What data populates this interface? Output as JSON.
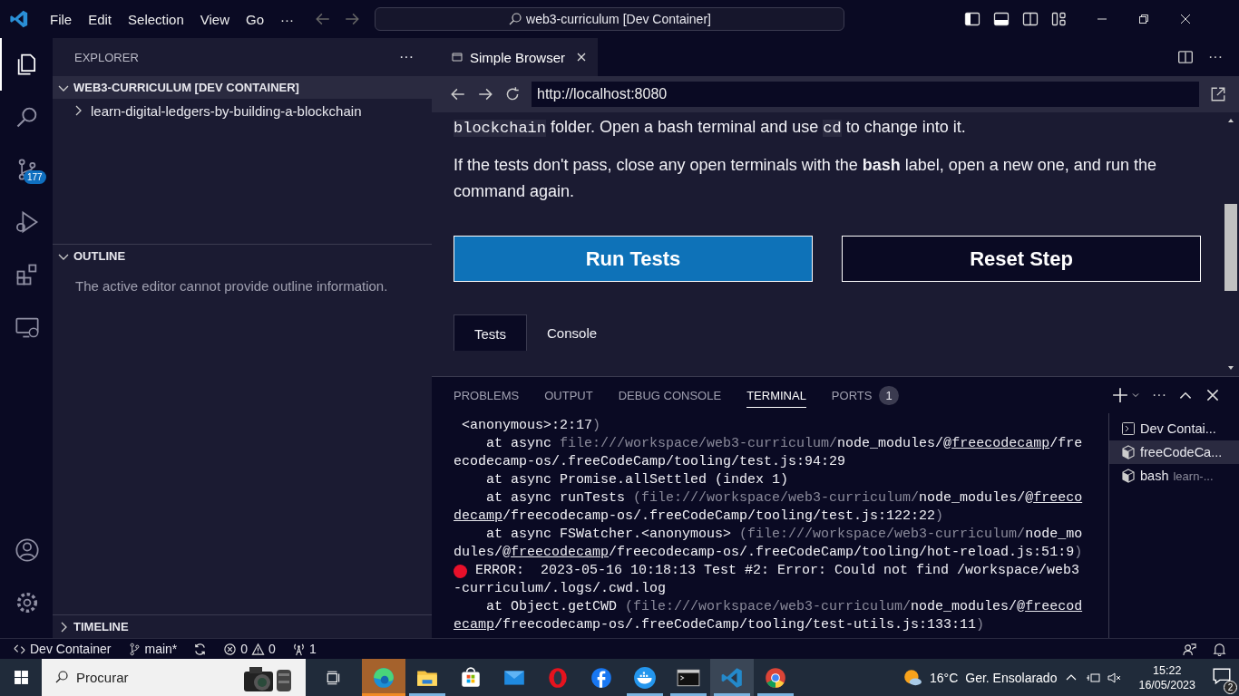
{
  "title_bar": {
    "menus": [
      "File",
      "Edit",
      "Selection",
      "View",
      "Go",
      "···"
    ],
    "command_center": "web3-curriculum [Dev Container]",
    "layout_toggles": [
      {
        "kind": "primary-sidebar",
        "on": true
      },
      {
        "kind": "panel",
        "on": true
      },
      {
        "kind": "secondary-sidebar",
        "on": false
      },
      {
        "kind": "customize"
      }
    ]
  },
  "activity_bar": {
    "top": [
      {
        "kind": "explorer",
        "selected": true
      },
      {
        "kind": "search",
        "selected": false
      },
      {
        "kind": "source-control",
        "selected": false,
        "badge": "177"
      },
      {
        "kind": "run-debug",
        "selected": false
      },
      {
        "kind": "extensions",
        "selected": false
      },
      {
        "kind": "remote",
        "selected": false
      }
    ],
    "bottom": [
      {
        "kind": "account"
      },
      {
        "kind": "manage"
      }
    ]
  },
  "sidebar": {
    "title": "EXPLORER",
    "more": "···",
    "sections": [
      {
        "kind": "tree",
        "title": "WEB3-CURRICULUM [DEV CONTAINER]",
        "expanded": true,
        "items": [
          {
            "label": "learn-digital-ledgers-by-building-a-blockchain",
            "expanded": false
          }
        ]
      },
      {
        "kind": "message",
        "title": "OUTLINE",
        "expanded": true,
        "message": "The active editor cannot provide outline information."
      },
      {
        "kind": "collapsed",
        "title": "TIMELINE",
        "expanded": false
      }
    ]
  },
  "editor": {
    "tabs": [
      {
        "label": "Simple Browser",
        "selected": true
      }
    ],
    "browser": {
      "url": "http://localhost:8080",
      "first_line": [
        {
          "kind": "code",
          "text": "blockchain"
        },
        {
          "kind": "text",
          "text": " folder. Open a bash terminal and use "
        },
        {
          "kind": "code",
          "text": "cd"
        },
        {
          "kind": "text",
          "text": " to change into it."
        }
      ],
      "paragraph": "If the tests don't pass, close any open terminals with the **bash** label, open a new one, and run the command again.",
      "buttons": [
        {
          "label": "Run Tests",
          "kind": "primary"
        },
        {
          "label": "Reset Step",
          "kind": "secondary"
        }
      ],
      "tabs": [
        {
          "label": "Tests",
          "selected": true
        },
        {
          "label": "Console",
          "selected": false
        }
      ]
    }
  },
  "panel": {
    "tabs": [
      {
        "label": "PROBLEMS",
        "selected": false
      },
      {
        "label": "OUTPUT",
        "selected": false
      },
      {
        "label": "DEBUG CONSOLE",
        "selected": false
      },
      {
        "label": "TERMINAL",
        "selected": true
      },
      {
        "label": "PORTS",
        "selected": false,
        "badge": "1"
      }
    ],
    "terminal_lines": [
      {
        "error": false,
        "segments": [
          {
            "kind": "plain",
            "text": " <anonymous>:2:17"
          },
          {
            "kind": "dim",
            "text": ")"
          }
        ]
      },
      {
        "error": false,
        "segments": [
          {
            "kind": "plain",
            "text": "    at async "
          },
          {
            "kind": "dim",
            "text": "file:///workspace/web3-curriculum/"
          },
          {
            "kind": "plain",
            "text": "node_modules/@"
          },
          {
            "kind": "link",
            "text": "freecodecamp"
          },
          {
            "kind": "plain",
            "text": "/fre"
          }
        ]
      },
      {
        "error": false,
        "segments": [
          {
            "kind": "plain",
            "text": "ecodecamp-os/.freeCodeCamp/tooling/test.js:94:29"
          }
        ]
      },
      {
        "error": false,
        "segments": [
          {
            "kind": "plain",
            "text": "    at async Promise.allSettled (index 1)"
          }
        ]
      },
      {
        "error": false,
        "segments": [
          {
            "kind": "plain",
            "text": "    at async runTests "
          },
          {
            "kind": "dim",
            "text": "(file:///workspace/web3-curriculum/"
          },
          {
            "kind": "plain",
            "text": "node_modules/@"
          },
          {
            "kind": "link",
            "text": "freeco"
          }
        ]
      },
      {
        "error": false,
        "segments": [
          {
            "kind": "link",
            "text": "decamp"
          },
          {
            "kind": "plain",
            "text": "/freecodecamp-os/.freeCodeCamp/tooling/test.js:122:22"
          },
          {
            "kind": "dim",
            "text": ")"
          }
        ]
      },
      {
        "error": false,
        "segments": [
          {
            "kind": "plain",
            "text": "    at async FSWatcher.<anonymous> "
          },
          {
            "kind": "dim",
            "text": "(file:///workspace/web3-curriculum/"
          },
          {
            "kind": "plain",
            "text": "node_mo"
          }
        ]
      },
      {
        "error": false,
        "segments": [
          {
            "kind": "plain",
            "text": "dules/@"
          },
          {
            "kind": "link",
            "text": "freecodecamp"
          },
          {
            "kind": "plain",
            "text": "/freecodecamp-os/.freeCodeCamp/tooling/hot-reload.js:51:9"
          },
          {
            "kind": "dim",
            "text": ")"
          }
        ]
      },
      {
        "error": true,
        "segments": [
          {
            "kind": "plain",
            "text": " ERROR:  2023-05-16 10:18:13 Test #2: Error: Could not find /workspace/web3"
          }
        ]
      },
      {
        "error": false,
        "segments": [
          {
            "kind": "plain",
            "text": "-curriculum/.logs/.cwd.log"
          }
        ]
      },
      {
        "error": false,
        "segments": [
          {
            "kind": "plain",
            "text": "    at Object.getCWD "
          },
          {
            "kind": "dim",
            "text": "(file:///workspace/web3-curriculum/"
          },
          {
            "kind": "plain",
            "text": "node_modules/@"
          },
          {
            "kind": "link",
            "text": "freecod"
          }
        ]
      },
      {
        "error": false,
        "segments": [
          {
            "kind": "link",
            "text": "ecamp"
          },
          {
            "kind": "plain",
            "text": "/freecodecamp-os/.freeCodeCamp/tooling/test-utils.js:133:11"
          },
          {
            "kind": "dim",
            "text": ")"
          }
        ]
      }
    ],
    "terminals": [
      {
        "kind": "shell",
        "label": "Dev Contai...",
        "selected": false
      },
      {
        "kind": "task",
        "label": "freeCodeCa...",
        "selected": true
      },
      {
        "kind": "task",
        "label": "bash",
        "detail": "learn-...",
        "selected": false
      }
    ]
  },
  "status_bar": {
    "left": [
      {
        "kind": "remote",
        "label": "Dev Container"
      },
      {
        "kind": "branch",
        "label": "main*"
      },
      {
        "kind": "sync"
      },
      {
        "kind": "problems",
        "errors": "0",
        "warnings": "0"
      },
      {
        "kind": "ports",
        "label": "1"
      }
    ],
    "right": [
      {
        "kind": "feedback"
      },
      {
        "kind": "bell"
      }
    ]
  },
  "taskbar": {
    "search_placeholder": "Procurar",
    "apps": [
      {
        "kind": "edge",
        "running": true,
        "flashing": true,
        "selected": false
      },
      {
        "kind": "files",
        "running": true,
        "flashing": false,
        "selected": false
      },
      {
        "kind": "store",
        "running": false,
        "flashing": false,
        "selected": false
      },
      {
        "kind": "mail",
        "running": false,
        "flashing": false,
        "selected": false
      },
      {
        "kind": "opera",
        "running": false,
        "flashing": false,
        "selected": false
      },
      {
        "kind": "facebook",
        "running": false,
        "flashing": false,
        "selected": false
      },
      {
        "kind": "docker",
        "running": true,
        "flashing": false,
        "selected": false
      },
      {
        "kind": "terminal",
        "running": true,
        "flashing": false,
        "selected": false
      },
      {
        "kind": "vscode",
        "running": true,
        "flashing": false,
        "selected": true
      },
      {
        "kind": "chrome",
        "running": true,
        "flashing": false,
        "selected": false
      }
    ],
    "weather": {
      "temperature": "16°C",
      "condition": "Ger. Ensolarado"
    },
    "time": "15:22",
    "date": "16/05/2023",
    "notifications": "2"
  }
}
